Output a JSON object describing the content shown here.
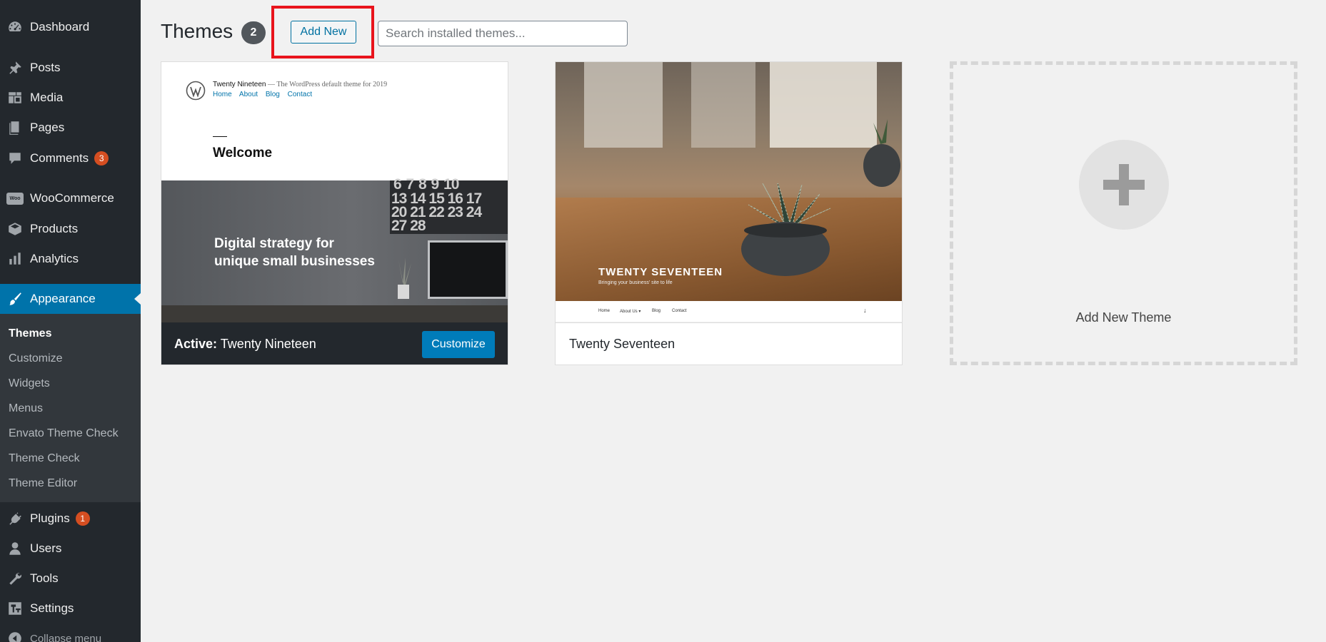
{
  "sidebar": {
    "items": [
      {
        "label": "Dashboard",
        "icon": "dashboard-icon"
      },
      {
        "label": "Posts",
        "icon": "pin-icon"
      },
      {
        "label": "Media",
        "icon": "media-icon"
      },
      {
        "label": "Pages",
        "icon": "pages-icon"
      },
      {
        "label": "Comments",
        "icon": "comment-icon",
        "badge": "3"
      },
      {
        "label": "WooCommerce",
        "icon": "woocommerce-icon",
        "icon_text": "Woo"
      },
      {
        "label": "Products",
        "icon": "box-icon"
      },
      {
        "label": "Analytics",
        "icon": "bar-chart-icon"
      },
      {
        "label": "Appearance",
        "icon": "paintbrush-icon",
        "active": true
      },
      {
        "label": "Plugins",
        "icon": "plug-icon",
        "badge": "1"
      },
      {
        "label": "Users",
        "icon": "user-icon"
      },
      {
        "label": "Tools",
        "icon": "wrench-icon"
      },
      {
        "label": "Settings",
        "icon": "settings-icon"
      },
      {
        "label": "Collapse menu",
        "icon": "collapse-icon"
      }
    ],
    "submenu": [
      {
        "label": "Themes",
        "current": true
      },
      {
        "label": "Customize"
      },
      {
        "label": "Widgets"
      },
      {
        "label": "Menus"
      },
      {
        "label": "Envato Theme Check"
      },
      {
        "label": "Theme Check"
      },
      {
        "label": "Theme Editor"
      }
    ],
    "colors": {
      "background": "#23282d",
      "submenu": "#32373c",
      "active": "#0073aa",
      "badge": "#d54e21"
    }
  },
  "header": {
    "title": "Themes",
    "count": "2",
    "add_new_label": "Add New",
    "search_placeholder": "Search installed themes...",
    "highlight_color": "#e8141c"
  },
  "themes": [
    {
      "name": "Twenty Nineteen",
      "active_prefix": "Active:",
      "active": true,
      "customize_label": "Customize",
      "preview": {
        "site_title": "Twenty Nineteen",
        "site_tagline": "— The WordPress default theme for 2019",
        "nav": [
          "Home",
          "About",
          "Blog",
          "Contact"
        ],
        "heading": "Welcome",
        "hero_line1": "Digital strategy for",
        "hero_line2": "unique small businesses",
        "calendar_rows": [
          "6 7 8 9 10",
          "13 14 15 16 17",
          "20 21 22 23 24",
          "27 28"
        ]
      }
    },
    {
      "name": "Twenty Seventeen",
      "active": false,
      "preview": {
        "title": "TWENTY SEVENTEEN",
        "tagline": "Bringing your business' site to life",
        "nav": [
          "Home",
          "About Us ▾",
          "Blog",
          "Contact"
        ]
      }
    }
  ],
  "add_new_theme_label": "Add New Theme"
}
